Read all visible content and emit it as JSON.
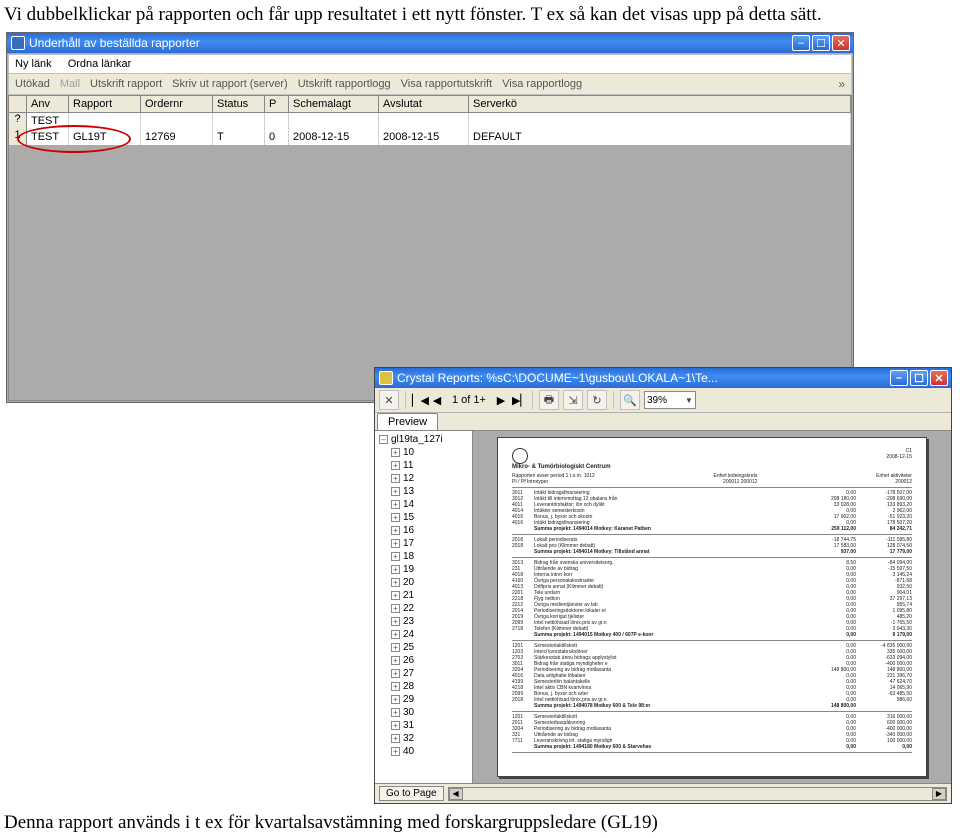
{
  "body_text_top": "Vi dubbelklickar på rapporten och får upp resultatet i ett nytt fönster. T ex så kan det visas upp på detta sätt.",
  "body_text_bottom": "Denna rapport används i t ex för kvartalsavstämning med forskargruppsledare (GL19)",
  "shot1": {
    "title": "Underhåll av beställda rapporter",
    "menubar": {
      "nylank": "Ny länk",
      "ordna": "Ordna länkar"
    },
    "toolbar": {
      "utokad": "Utökad",
      "mall": "Mall",
      "utskrift": "Utskrift rapport",
      "skriv_server": "Skriv ut rapport (server)",
      "utskrift_log": "Utskrift rapportlogg",
      "visa_utskrift": "Visa rapportutskrift",
      "visa_log": "Visa rapportlogg"
    },
    "cols": {
      "anv": "Anv",
      "rapport": "Rapport",
      "ordernr": "Ordernr",
      "status": "Status",
      "p": "P",
      "schemalagt": "Schemalagt",
      "avslutat": "Avslutat",
      "serverko": "Serverkö"
    },
    "rows": [
      {
        "mark": "?",
        "anv": "TEST",
        "rapport": "",
        "ordernr": "",
        "status": "",
        "p": "",
        "schemalagt": "",
        "avslutat": "",
        "serverko": ""
      },
      {
        "mark": "1",
        "anv": "TEST",
        "rapport": "GL19T",
        "ordernr": "12769",
        "status": "T",
        "p": "0",
        "schemalagt": "2008-12-15",
        "avslutat": "2008-12-15",
        "serverko": "DEFAULT"
      }
    ]
  },
  "cr": {
    "title": "Crystal Reports: %sC:\\DOCUME~1\\gusbou\\LOKALA~1\\Te...",
    "page_of": "1 of 1+",
    "zoom": "39%",
    "tab_preview": "Preview",
    "tree_root": "gl19ta_127i",
    "tree_items": [
      "10",
      "11",
      "12",
      "13",
      "14",
      "15",
      "16",
      "17",
      "18",
      "19",
      "20",
      "21",
      "22",
      "23",
      "24",
      "25",
      "26",
      "27",
      "28",
      "29",
      "30",
      "31",
      "32",
      "40"
    ],
    "gotopage": "Go to Page",
    "report": {
      "corner": "C1",
      "date_right": "2008-12-15",
      "heading": "Mikro- & Tumörbiologiskt Centrum",
      "sub1_l": "Rapporten avser period 1 t.o.m. 1012",
      "sub1_m": "Enhet ledningskrets",
      "sub1_md": "200011   200012",
      "sub1_r": "Enhet aktiviteter",
      "sub1_rd": "200012",
      "sub2": "PI / Pf Introtyper",
      "block1": [
        {
          "a": "3011",
          "b": "Intäkt bidragsfinansiering",
          "c": "0,00",
          "d": "-178 507,00"
        },
        {
          "a": "3012",
          "b": "Intäkt till internmottag 12 obalans från",
          "c": "208 180,00",
          "d": "-208 690,00"
        },
        {
          "a": "4011",
          "b": "Leverantörsfaktor; lön och dylikt",
          "c": "33 028,00",
          "d": "133 893,20"
        },
        {
          "a": "4014",
          "b": "Intäkter semesterkostn",
          "c": "0,00",
          "d": "2 962,00"
        },
        {
          "a": "4016",
          "b": "Bonus, j. byxor och skostn",
          "c": "17 902,00",
          "d": "-51 923,20"
        },
        {
          "a": "4016",
          "b": "Intäkt bidragsfinansiering",
          "c": "0,00",
          "d": "178 507,20"
        }
      ],
      "sum1": {
        "label": "Summa projekt:   1494014   Motkey: Karanet Patben",
        "c": "259 112,00",
        "d": "84 242,71"
      },
      "block2": [
        {
          "a": "2018",
          "b": "Lokalt periodiserats",
          "c": "-18 744,75",
          "d": "-111 095,80"
        },
        {
          "a": "2018",
          "b": "Lokalt pris (Klimmer debatt)",
          "c": "17 583,00",
          "d": "128 074,50"
        }
      ],
      "sum2": {
        "label": "Summa projekt:   1494014   Motkey: Tillstånd annat",
        "c": "937,00",
        "d": "17 779,00"
      },
      "block3": [
        {
          "a": "3013",
          "b": "Bidrag från svenska universitetsorg.",
          "c": "8,50",
          "d": "-84 094,00"
        },
        {
          "a": "231",
          "b": "Uttrående av bidrag",
          "c": "0,00",
          "d": "-15 597,50"
        },
        {
          "a": "4018",
          "b": "Interna intrer korr",
          "c": "0,00",
          "d": "3 145,24"
        },
        {
          "a": "4160",
          "b": "Övriga personalakostnader",
          "c": "0,00",
          "d": "-871,68"
        },
        {
          "a": "4013",
          "b": "Driftpris annat (Klimmer debatt)",
          "c": "0,00",
          "d": "932,50"
        },
        {
          "a": "2201",
          "b": "Tele undarn",
          "c": "0,00",
          "d": "904,01"
        },
        {
          "a": "2218",
          "b": "Flyg nettion",
          "c": "0,00",
          "d": "37 297,13"
        },
        {
          "a": "2212",
          "b": "Övriga medientjänster av lab",
          "c": "0,00",
          "d": "955,74"
        },
        {
          "a": "2014",
          "b": "Periodiseringsdoktorer lokaler et",
          "c": "0,00",
          "d": "1 095,80"
        },
        {
          "a": "2019",
          "b": "Övriga korrigut tjelister",
          "c": "0,00",
          "d": "485,20"
        },
        {
          "a": "2099",
          "b": "Intel nettiöhisad lönix.pris av gr.n",
          "c": "0,00",
          "d": "-1 765,50"
        },
        {
          "a": "2718",
          "b": "Telefon (Klimmer debatt)",
          "c": "0,00",
          "d": "3 943,30"
        }
      ],
      "sum3": {
        "label": "Summa projekt:   1494015   Motkey 400 / 607P e-konr",
        "c": "0,00",
        "d": "9 179,00"
      },
      "block4": [
        {
          "a": "1201",
          "b": "Semesterlaktillskott",
          "c": "0,00",
          "d": "-4 835 000,00"
        },
        {
          "a": "1203",
          "b": "Interd kvorstabrukslöner",
          "c": "0,00",
          "d": "335 000,00"
        },
        {
          "a": "2703",
          "b": "Stärkesstab ännu bidrags applystylist",
          "c": "0,00",
          "d": "-633 094,00"
        },
        {
          "a": "3011",
          "b": "Bidrag från statiga myndigheter e",
          "c": "0,00",
          "d": "-400 000,00"
        },
        {
          "a": "3204",
          "b": "Periodisering av bidrag motlaxanta",
          "c": "148 800,00",
          "d": "148 800,00"
        },
        {
          "a": "4016",
          "b": "Data artighalte löbalanr",
          "c": "0,00",
          "d": "231 396,70"
        },
        {
          "a": "4199",
          "b": "Semesterlön balantakelle",
          "c": "0,00",
          "d": "47 624,70"
        },
        {
          "a": "4218",
          "b": "Intel aktiv CBN kvartvinna",
          "c": "0,00",
          "d": "14 065,90"
        },
        {
          "a": "2099",
          "b": "Bonus, j. byxor och arter",
          "c": "0,00",
          "d": "-63 485,50"
        },
        {
          "a": "2018",
          "b": "Intel nettiöhisad lönix.pris av gr.n",
          "c": "0,00",
          "d": "986,60"
        }
      ],
      "sum4": {
        "label": "Summa projekt:   1494078   Motkey 600 & Tele 98:er",
        "c": "148 800,00",
        "d": ""
      },
      "block5": [
        {
          "a": "1201",
          "b": "Semesterlaktillskott",
          "c": "0,00",
          "d": "316 000,00"
        },
        {
          "a": "2011",
          "b": "Semesterbaspåkvoring",
          "c": "0,00",
          "d": "600 000,00"
        },
        {
          "a": "3204",
          "b": "Periodisering av bidrag motlaxanta",
          "c": "0,00",
          "d": "-400 000,00"
        },
        {
          "a": "331",
          "b": "Uttrående av bidrag",
          "c": "0,00",
          "d": "-340 000,00"
        },
        {
          "a": "7711",
          "b": "Leveranskrivng int. statiga myndigh",
          "c": "0,00",
          "d": "100 000,00"
        }
      ],
      "sum5": {
        "label": "Summa projekt:   1494180   Motkey 600 & Starvehav",
        "c": "0,00",
        "d": "0,00"
      }
    }
  }
}
